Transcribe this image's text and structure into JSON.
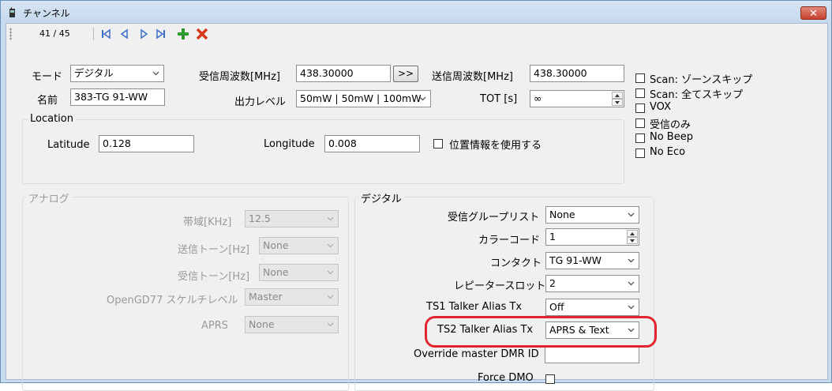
{
  "window": {
    "title": "チャンネル",
    "close_label": "✕"
  },
  "toolbar": {
    "counter": "41 / 45"
  },
  "colors": {
    "highlight": "#e1262d",
    "add": "#2e9b2e",
    "delete": "#d43a1a",
    "nav": "#3a6fc4"
  },
  "icons": [
    "phone-icon",
    "first-record-icon",
    "previous-record-icon",
    "next-record-icon",
    "last-record-icon",
    "add-icon",
    "delete-icon",
    "chevron-down-icon"
  ],
  "mode": {
    "label": "モード",
    "value": "デジタル"
  },
  "name": {
    "label": "名前",
    "value": "383-TG 91-WW"
  },
  "rx_freq": {
    "label": "受信周波数[MHz]",
    "value": "438.30000",
    "copy_button": ">>"
  },
  "power": {
    "label": "出力レベル",
    "value": "50mW | 50mW | 100mW"
  },
  "tx_freq": {
    "label": "送信周波数[MHz]",
    "value": "438.30000"
  },
  "tot": {
    "label": "TOT [s]",
    "value": "∞"
  },
  "options": [
    {
      "label": "Scan: ゾーンスキップ",
      "checked": false
    },
    {
      "label": "Scan: 全てスキップ",
      "checked": false
    },
    {
      "label": "VOX",
      "checked": false
    },
    {
      "label": "受信のみ",
      "checked": false
    },
    {
      "label": "No Beep",
      "checked": false
    },
    {
      "label": "No Eco",
      "checked": false
    }
  ],
  "location": {
    "title": "Location",
    "latitude_label": "Latitude",
    "latitude": "0.128",
    "longitude_label": "Longitude",
    "longitude": "0.008",
    "use_label": "位置情報を使用する",
    "use_checked": false
  },
  "analog": {
    "title": "アナログ",
    "bandwidth_label": "帯域[KHz]",
    "bandwidth": "12.5",
    "tx_tone_label": "送信トーン[Hz]",
    "tx_tone": "None",
    "rx_tone_label": "受信トーン[Hz]",
    "rx_tone": "None",
    "squelch_label": "OpenGD77 スケルチレベル",
    "squelch": "Master",
    "aprs_label": "APRS",
    "aprs": "None"
  },
  "digital": {
    "title": "デジタル",
    "rx_group_label": "受信グループリスト",
    "rx_group": "None",
    "color_code_label": "カラーコード",
    "color_code": "1",
    "contact_label": "コンタクト",
    "contact": "TG 91-WW",
    "slot_label": "レピータースロット",
    "slot": "2",
    "ts1_label": "TS1 Talker Alias Tx",
    "ts1": "Off",
    "ts2_label": "TS2 Talker Alias Tx",
    "ts2": "APRS & Text",
    "dmr_id_label": "Override master DMR ID",
    "dmr_id": "",
    "force_dmo_label": "Force DMO",
    "force_dmo": false
  }
}
